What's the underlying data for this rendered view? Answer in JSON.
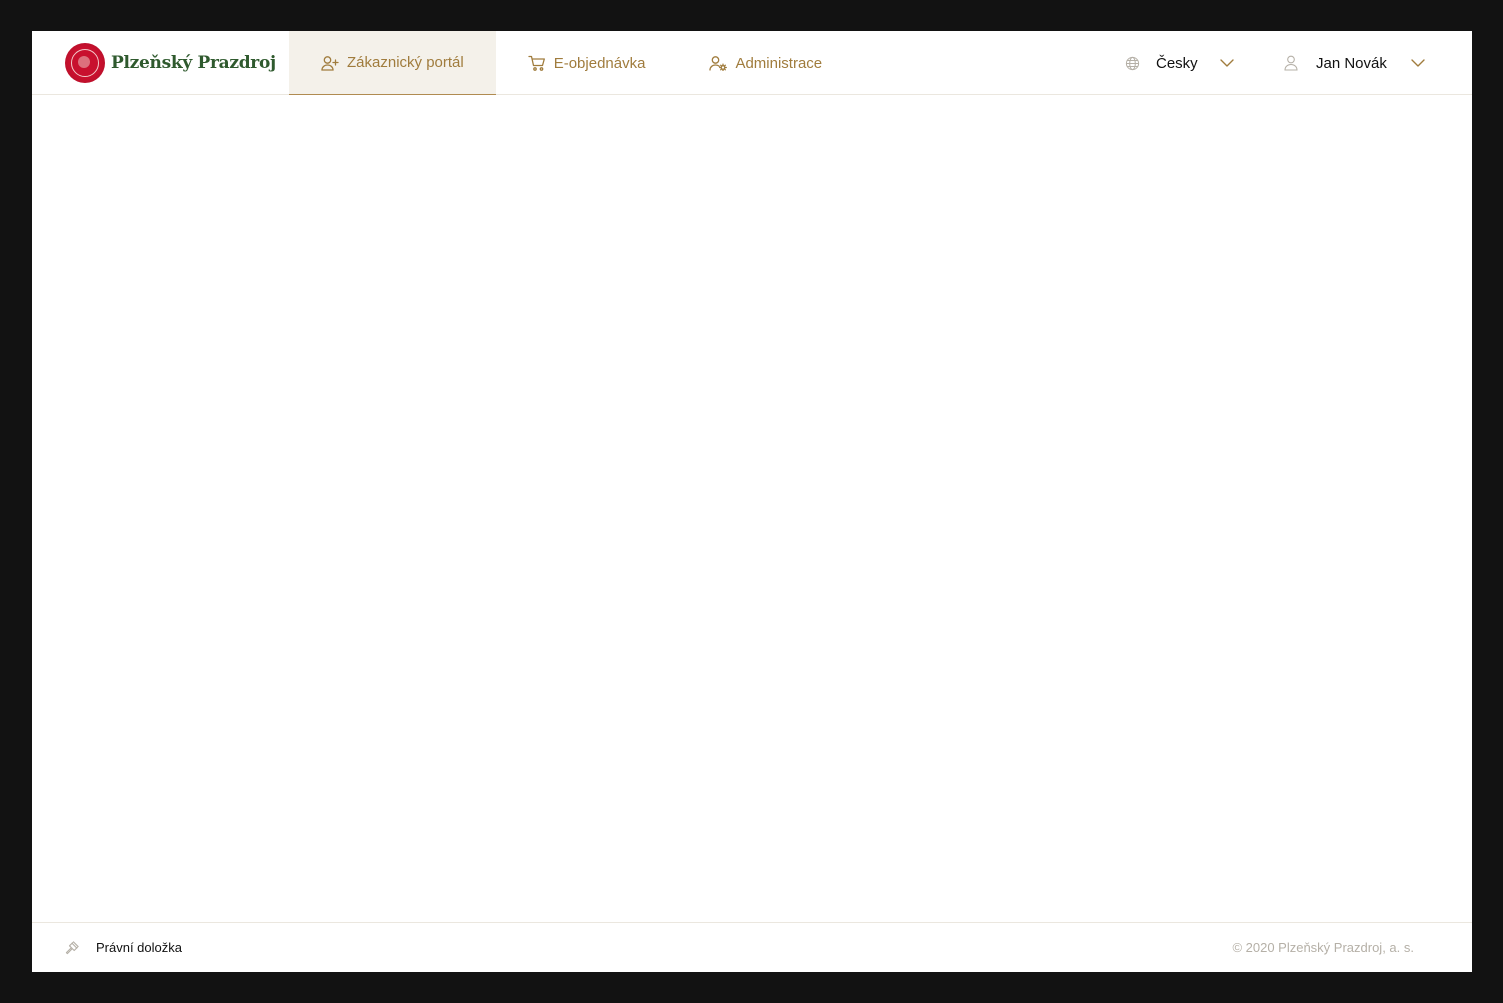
{
  "header": {
    "logo_text": "Plzeňský Prazdroj",
    "nav": [
      {
        "label": "Zákaznický portál",
        "icon": "user-plus-icon",
        "active": true
      },
      {
        "label": "E-objednávka",
        "icon": "cart-icon",
        "active": false
      },
      {
        "label": "Administrace",
        "icon": "user-gear-icon",
        "active": false
      }
    ],
    "language": {
      "label": "Česky",
      "icon": "globe-icon"
    },
    "user": {
      "name": "Jan Novák",
      "icon": "user-icon"
    }
  },
  "footer": {
    "legal_link": "Právní doložka",
    "legal_icon": "gavel-icon",
    "copyright": "© 2020 Plzeňský Prazdroj, a. s."
  },
  "colors": {
    "accent": "#a07c3d",
    "logo_green": "#2f5a2e",
    "logo_red": "#c8102e",
    "active_tab_bg": "#f4f1ea",
    "muted_text": "#b5b0a7"
  }
}
